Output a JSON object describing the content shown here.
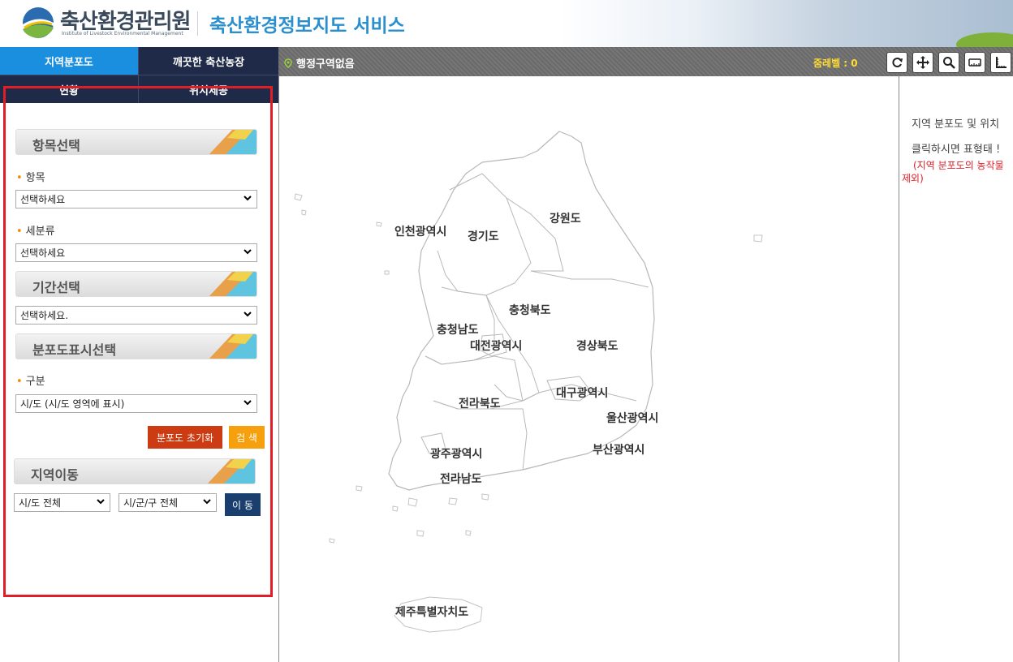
{
  "header": {
    "org_name": "축산환경관리원",
    "org_sub": "Institute of Livestock Environmental Management",
    "service_title": "축산환경정보지도 서비스"
  },
  "tabs": [
    {
      "label": "지역분포도",
      "active": true
    },
    {
      "label": "깨끗한 축산농장",
      "active": false
    },
    {
      "label": "현황",
      "active": false
    },
    {
      "label": "위치제공",
      "active": false
    }
  ],
  "sections": {
    "item_select": "항목선택",
    "period_select": "기간선택",
    "display_select": "분포도표시선택",
    "region_move": "지역이동"
  },
  "fields": {
    "item_label": "항목",
    "item_value": "선택하세요",
    "subclass_label": "세분류",
    "subclass_value": "선택하세요",
    "period_value": "선택하세요.",
    "category_label": "구분",
    "category_value": "시/도 (시/도 영역에 표시)",
    "sido_value": "시/도 전체",
    "sigungu_value": "시/군/구 전체"
  },
  "buttons": {
    "reset": "분포도 초기화",
    "search": "검 색",
    "move": "이 동"
  },
  "map": {
    "location_text": "행정구역없음",
    "zoom_level": "줌레벨 : 0",
    "regions": [
      "인천광역시",
      "경기도",
      "강원도",
      "충청북도",
      "충청남도",
      "대전광역시",
      "경상북도",
      "대구광역시",
      "전라북도",
      "울산광역시",
      "부산광역시",
      "광주광역시",
      "전라남도",
      "제주특별자치도"
    ]
  },
  "toolbar": [
    "refresh-icon",
    "pan-icon",
    "search-icon",
    "measure-distance-icon",
    "measure-area-icon"
  ],
  "info": {
    "line1": "지역 분포도 및 위치",
    "line2": "클릭하시면 표형태 !",
    "note1": "(지역 분포도의 농작물",
    "note2": "제외)"
  },
  "colors": {
    "active_tab": "#1a8fe0",
    "tab_bg": "#1e2a48",
    "reset_button": "#cc3b12",
    "search_button": "#f5a00c",
    "move_button": "#1a3f6e",
    "highlight_frame": "#e01e28",
    "title": "#2a8fcf"
  }
}
